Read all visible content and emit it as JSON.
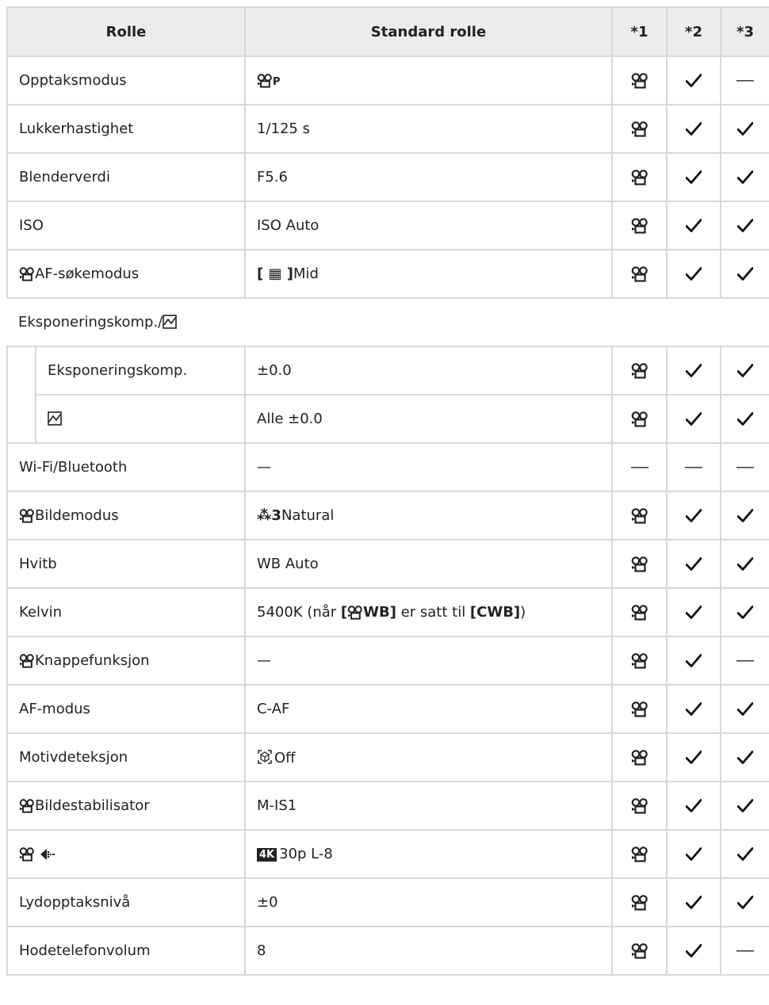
{
  "header": {
    "col_role": "Rolle",
    "col_default": "Standard rolle",
    "col_1": "*1",
    "col_2": "*2",
    "col_3": "*3"
  },
  "rows": [
    {
      "role": "Opptaksmodus",
      "default": "P",
      "m1": "movie",
      "m2": "check",
      "m3": "dash"
    },
    {
      "role": "Lukkerhastighet",
      "default": "1/125 s",
      "m1": "movie",
      "m2": "check",
      "m3": "check"
    },
    {
      "role": "Blenderverdi",
      "default": "F5.6",
      "m1": "movie",
      "m2": "check",
      "m3": "check"
    },
    {
      "role": "ISO",
      "default": "ISO Auto",
      "m1": "movie",
      "m2": "check",
      "m3": "check"
    },
    {
      "role": "AF-søkemodus",
      "default": "Mid",
      "m1": "movie",
      "m2": "check",
      "m3": "check"
    },
    {
      "role": "Eksponeringskomp./"
    },
    {
      "role": "Eksponeringskomp.",
      "default": "±0.0",
      "m1": "movie",
      "m2": "check",
      "m3": "check"
    },
    {
      "role": "",
      "default": "Alle ±0.0",
      "m1": "movie",
      "m2": "check",
      "m3": "check"
    },
    {
      "role": "Wi-Fi/Bluetooth",
      "default": "—",
      "m1": "dash",
      "m2": "dash",
      "m3": "dash"
    },
    {
      "role": "Bildemodus",
      "default_prefix": "3",
      "default": "Natural",
      "m1": "movie",
      "m2": "check",
      "m3": "check"
    },
    {
      "role": "Hvitb",
      "default": "WB Auto",
      "m1": "movie",
      "m2": "check",
      "m3": "check"
    },
    {
      "role": "Kelvin",
      "default_a": "5400K (når ",
      "default_b": "[",
      "default_c": "WB]",
      "default_d": " er satt til ",
      "default_e": "[CWB]",
      "default_f": ")",
      "m1": "movie",
      "m2": "check",
      "m3": "check"
    },
    {
      "role": "Knappefunksjon",
      "default": "—",
      "m1": "movie",
      "m2": "check",
      "m3": "dash"
    },
    {
      "role": "AF-modus",
      "default": "C-AF",
      "m1": "movie",
      "m2": "check",
      "m3": "check"
    },
    {
      "role": "Motivdeteksjon",
      "default": "Off",
      "m1": "movie",
      "m2": "check",
      "m3": "check"
    },
    {
      "role": "Bildestabilisator",
      "default": "M-IS1",
      "m1": "movie",
      "m2": "check",
      "m3": "check"
    },
    {
      "role": "",
      "default_badge": "4K",
      "default": "30p L-8",
      "m1": "movie",
      "m2": "check",
      "m3": "check"
    },
    {
      "role": "Lydopptaksnivå",
      "default": "±0",
      "m1": "movie",
      "m2": "check",
      "m3": "check"
    },
    {
      "role": "Hodetelefonvolum",
      "default": "8",
      "m1": "movie",
      "m2": "check",
      "m3": "dash"
    }
  ]
}
